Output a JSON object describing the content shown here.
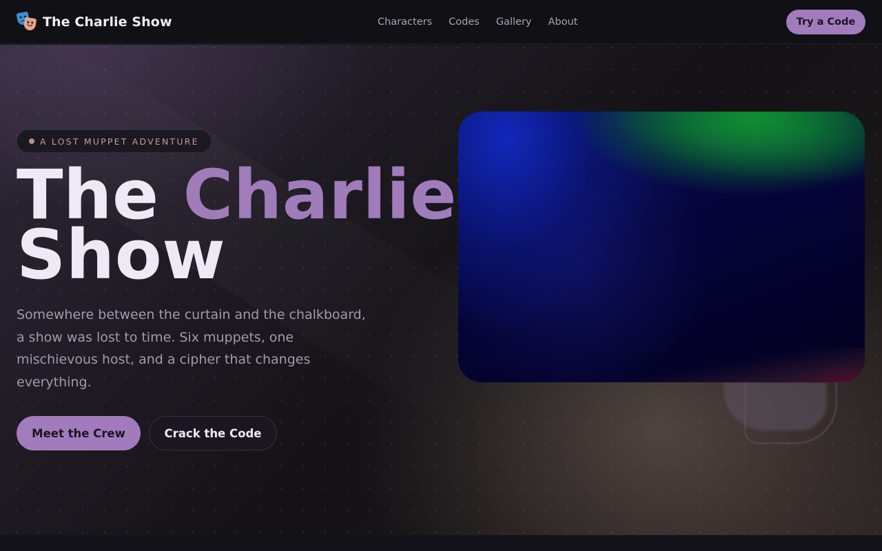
{
  "nav": {
    "brand": "The Charlie Show",
    "brand_icon": "theater-masks-icon",
    "links": [
      "Characters",
      "Codes",
      "Gallery",
      "About"
    ],
    "cta": "Try a Code"
  },
  "hero": {
    "tagline": "A LOST MUPPET ADVENTURE",
    "title_the": "The",
    "title_charlie": "Charlie",
    "title_show": "Show",
    "description": "Somewhere between the curtain and the chalkboard, a show was lost to time. Six muppets, one mischievous host, and a cipher that changes everything.",
    "primary_button": "Meet the Crew",
    "secondary_button": "Crack the Code"
  },
  "colors": {
    "accent": "#a27bbd",
    "background": "#131218",
    "tag_dot": "#b99088"
  }
}
